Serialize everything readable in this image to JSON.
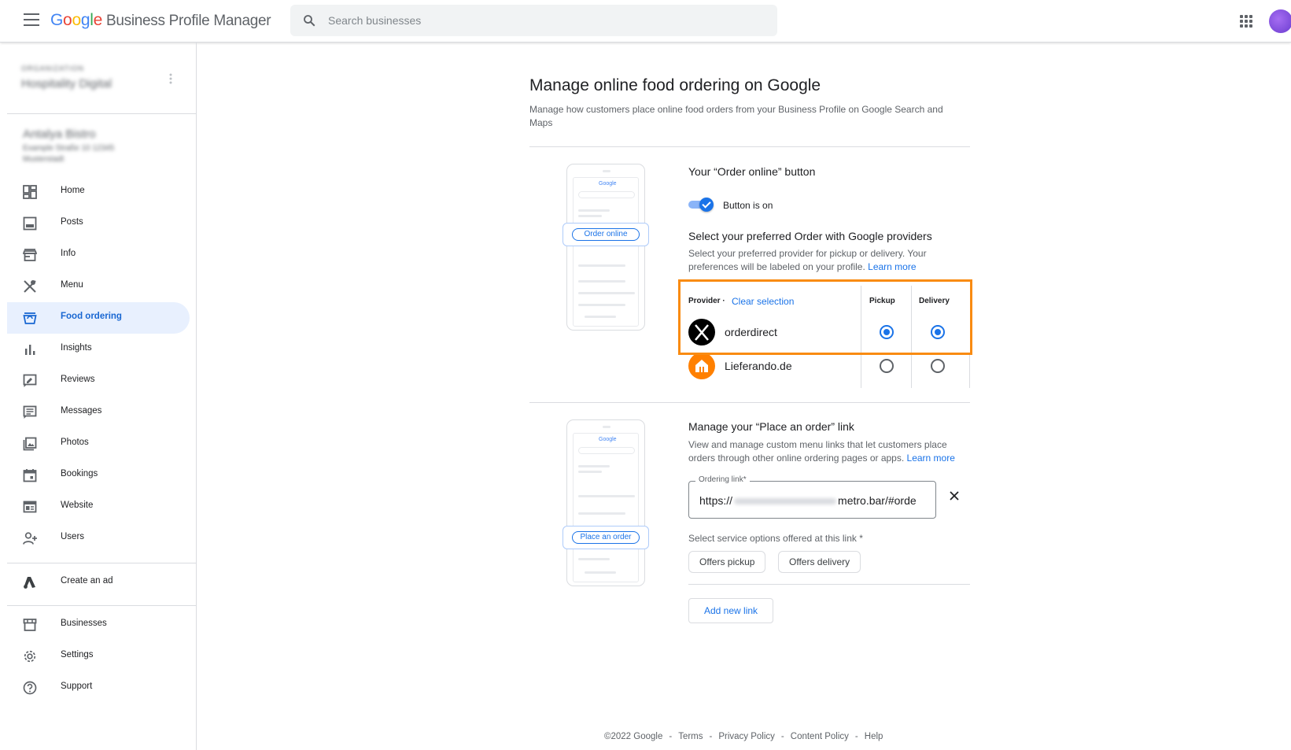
{
  "app": {
    "logo": [
      "G",
      "o",
      "o",
      "g",
      "l",
      "e"
    ],
    "product": "Business Profile Manager",
    "search_placeholder": "Search businesses"
  },
  "sidebar": {
    "org_label": "ORGANIZATION",
    "org_name": "Hospitality Digital",
    "business_name": "Antalya Bistro",
    "business_address": "Example Straße 10 12345 Musterstadt",
    "nav": [
      {
        "label": "Home",
        "icon": "dashboard-icon"
      },
      {
        "label": "Posts",
        "icon": "posts-icon"
      },
      {
        "label": "Info",
        "icon": "storefront-icon"
      },
      {
        "label": "Menu",
        "icon": "utensils-icon"
      },
      {
        "label": "Food ordering",
        "icon": "shopping-basket-icon",
        "active": true
      },
      {
        "label": "Insights",
        "icon": "bar-chart-icon"
      },
      {
        "label": "Reviews",
        "icon": "reviews-icon"
      },
      {
        "label": "Messages",
        "icon": "messages-icon"
      },
      {
        "label": "Photos",
        "icon": "photos-icon"
      },
      {
        "label": "Bookings",
        "icon": "calendar-icon"
      },
      {
        "label": "Website",
        "icon": "website-icon"
      },
      {
        "label": "Users",
        "icon": "add-user-icon"
      }
    ],
    "ad": {
      "label": "Create an ad",
      "icon": "google-ads-icon"
    },
    "bottom": [
      {
        "label": "Businesses",
        "icon": "store-icon"
      },
      {
        "label": "Settings",
        "icon": "gear-icon"
      },
      {
        "label": "Support",
        "icon": "help-icon"
      }
    ]
  },
  "main": {
    "title": "Manage online food ordering on Google",
    "subtitle": "Manage how customers place online food orders from your Business Profile on Google Search and Maps",
    "phone_logo": "Google",
    "order_section": {
      "title": "Your “Order online” button",
      "phone_button": "Order online",
      "toggle_label": "Button is on",
      "toggle_on": true,
      "providers_title": "Select your preferred Order with Google providers",
      "providers_desc": "Select your preferred provider for pickup or delivery. Your preferences will be labeled on your profile. ",
      "learn_more": "Learn more",
      "table": {
        "provider_header": "Provider ·",
        "clear_selection": "Clear selection",
        "pickup_header": "Pickup",
        "delivery_header": "Delivery",
        "rows": [
          {
            "name": "orderdirect",
            "pickup": true,
            "delivery": true,
            "logo_color": "#000000"
          },
          {
            "name": "Lieferando.de",
            "pickup": false,
            "delivery": false,
            "logo_color": "#ff8000"
          }
        ]
      },
      "highlight_color": "#f98b12"
    },
    "link_section": {
      "title": "Manage your “Place an order” link",
      "phone_button": "Place an order",
      "desc": "View and manage custom menu links that let customers place orders through other online ordering pages or apps. ",
      "learn_more": "Learn more",
      "field_label": "Ordering link*",
      "field_prefix": "https://",
      "field_suffix": "metro.bar/#orde",
      "service_label": "Select service options offered at this link *",
      "chips": [
        "Offers pickup",
        "Offers delivery"
      ],
      "add_button": "Add new link"
    }
  },
  "footer": {
    "copyright": "©2022 Google",
    "links": [
      "Terms",
      "Privacy Policy",
      "Content Policy",
      "Help"
    ]
  }
}
